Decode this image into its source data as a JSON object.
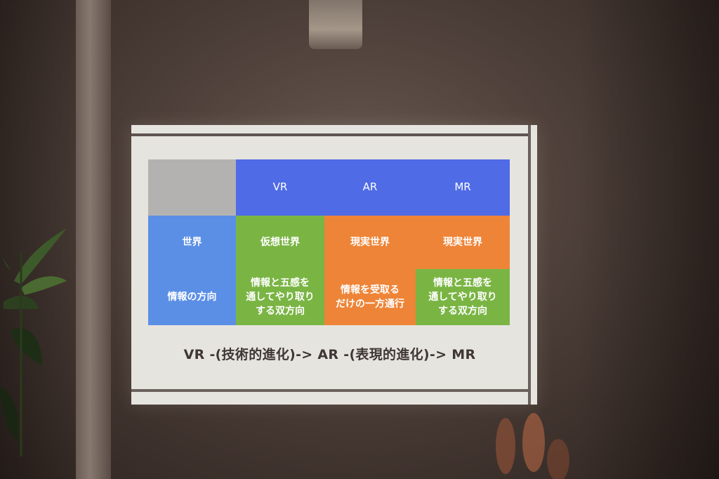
{
  "slide": {
    "table": {
      "header": [
        "",
        "VR",
        "AR",
        "MR"
      ],
      "row_world": [
        "世界",
        "仮想世界",
        "現実世界",
        "現実世界"
      ],
      "row_direction": [
        "情報の方向",
        "情報と五感を\n通してやり取り\nする双方向",
        "情報を受取る\nだけの一方通行",
        "情報と五感を\n通してやり取り\nする双方向"
      ]
    },
    "caption": "VR -(技術的進化)-> AR -(表現的進化)-> MR"
  },
  "colors": {
    "header_gray": "#b4b2b0",
    "header_blue": "#4f6be6",
    "label_blue": "#5b8fe6",
    "vr_green": "#7ab544",
    "ar_orange": "#ee8437",
    "mr_world_orange": "#ee8437",
    "mr_direction_green": "#7ab544"
  }
}
